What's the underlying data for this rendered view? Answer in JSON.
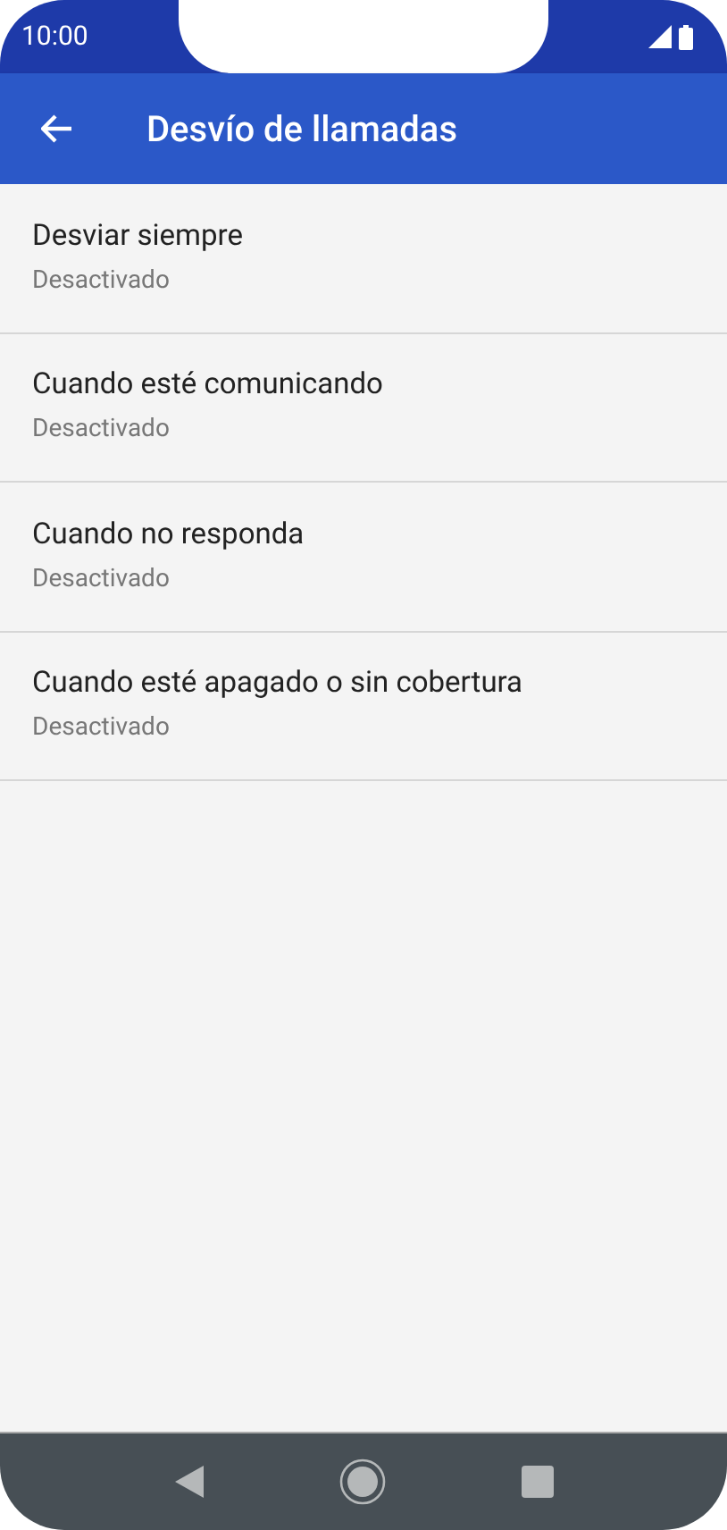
{
  "status_bar": {
    "time": "10:00"
  },
  "app_bar": {
    "title": "Desvío de llamadas"
  },
  "items": [
    {
      "title": "Desviar siempre",
      "subtitle": "Desactivado"
    },
    {
      "title": "Cuando esté comunicando",
      "subtitle": "Desactivado"
    },
    {
      "title": "Cuando no responda",
      "subtitle": "Desactivado"
    },
    {
      "title": "Cuando esté apagado o sin cobertura",
      "subtitle": "Desactivado"
    }
  ]
}
